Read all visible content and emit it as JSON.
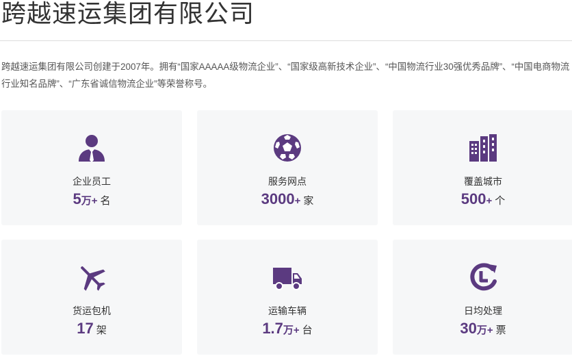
{
  "page": {
    "title": "跨越速运集团有限公司",
    "intro": "跨越速运集团有限公司创建于2007年。拥有“国家AAAAA级物流企业”、“国家级高新技术企业”、“中国物流行业30强优秀品牌”、“中国电商物流行业知名品牌”、“广东省诚信物流企业”等荣誉称号。"
  },
  "theme": {
    "accent": "#5b3a80",
    "card_bg": "#f6f7f8"
  },
  "stats": [
    {
      "icon": "employee-icon",
      "label": "企业员工",
      "number": "5",
      "unit": "万+",
      "measure": "名"
    },
    {
      "icon": "service-network-icon",
      "label": "服务网点",
      "number": "3000",
      "unit": "+",
      "measure": "家"
    },
    {
      "icon": "city-buildings-icon",
      "label": "覆盖城市",
      "number": "500",
      "unit": "+",
      "measure": "个"
    },
    {
      "icon": "airplane-icon",
      "label": "货运包机",
      "number": "17",
      "unit": "",
      "measure": "架"
    },
    {
      "icon": "truck-icon",
      "label": "运输车辆",
      "number": "1.7",
      "unit": "万+",
      "measure": "台"
    },
    {
      "icon": "daily-clock-icon",
      "label": "日均处理",
      "number": "30",
      "unit": "万+",
      "measure": "票"
    }
  ]
}
